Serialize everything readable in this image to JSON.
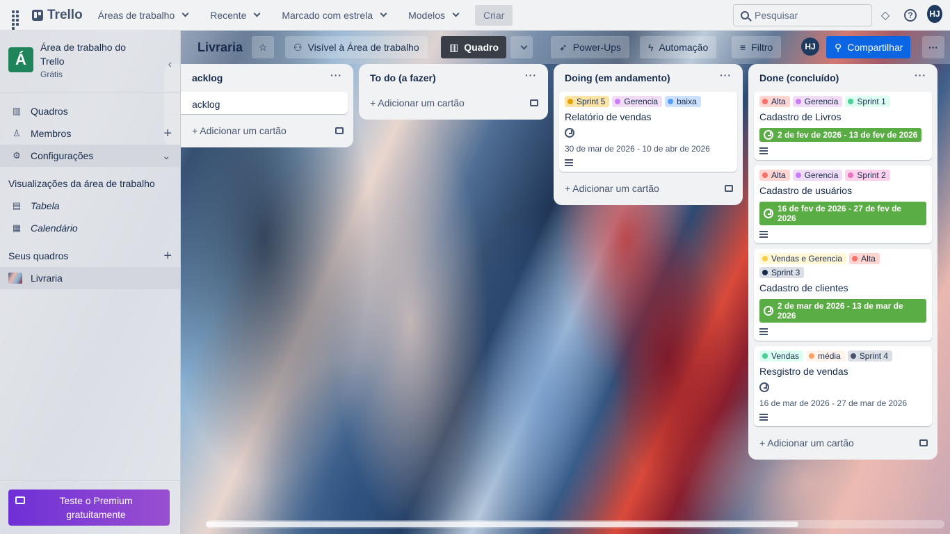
{
  "topbar": {
    "brand": "Trello",
    "nav": [
      "Áreas de trabalho",
      "Recente",
      "Marcado com estrela",
      "Modelos"
    ],
    "create_label": "Criar",
    "search_placeholder": "Pesquisar",
    "avatar_initials": "HJ"
  },
  "sidebar": {
    "workspace_initial": "Á",
    "workspace_name": "Área de trabalho do Trello",
    "workspace_plan": "Grátis",
    "items": [
      {
        "label": "Quadros"
      },
      {
        "label": "Membros"
      },
      {
        "label": "Configurações"
      }
    ],
    "views_heading": "Visualizações da área de trabalho",
    "views": [
      {
        "label": "Tabela"
      },
      {
        "label": "Calendário"
      }
    ],
    "boards_heading": "Seus quadros",
    "boards": [
      {
        "label": "Livraria"
      }
    ],
    "premium_label": "Teste o Premium gratuitamente"
  },
  "board": {
    "title": "Livraria",
    "visibility": "Visível à Área de trabalho",
    "view": "Quadro",
    "powerups": "Power-Ups",
    "automation": "Automação",
    "filter": "Filtro",
    "avatar_initials": "HJ",
    "share": "Compartilhar"
  },
  "add_card_label": "+ Adicionar um cartão",
  "lists": [
    {
      "name": "acklog",
      "cards": [
        {
          "title": "acklog"
        }
      ]
    },
    {
      "name": "To do (a fazer)",
      "cards": []
    },
    {
      "name": "Doing (em andamento)",
      "cards": [
        {
          "labels": [
            "Sprint 5",
            "Gerencia",
            "baixa"
          ],
          "title": "Relatório de vendas",
          "date": "30 de mar de 2026 - 10 de abr de 2026"
        }
      ]
    },
    {
      "name": "Done (concluído)",
      "cards": [
        {
          "labels": [
            "Alta",
            "Gerencia",
            "Sprint 1"
          ],
          "title": "Cadastro de Livros",
          "date": "2 de fev de 2026 - 13 de fev de 2026"
        },
        {
          "labels": [
            "Alta",
            "Gerencia",
            "Sprint 2"
          ],
          "title": "Cadastro de usuários",
          "date": "16 de fev de 2026 - 27 de fev de 2026"
        },
        {
          "labels": [
            "Vendas e Gerencia",
            "Alta",
            "Sprint 3"
          ],
          "title": "Cadastro de clientes",
          "date": "2 de mar de 2026 - 13 de mar de 2026"
        },
        {
          "labels": [
            "Vendas",
            "média",
            "Sprint 4"
          ],
          "title": "Resgistro de vendas",
          "date": "16 de mar de 2026 - 27 de mar de 2026"
        }
      ]
    }
  ],
  "colors": {
    "complete_date": "#5aac44",
    "share_button": "#0c66e4",
    "workspace_badge": "#1f845a",
    "premium": "#7c3ad4"
  }
}
